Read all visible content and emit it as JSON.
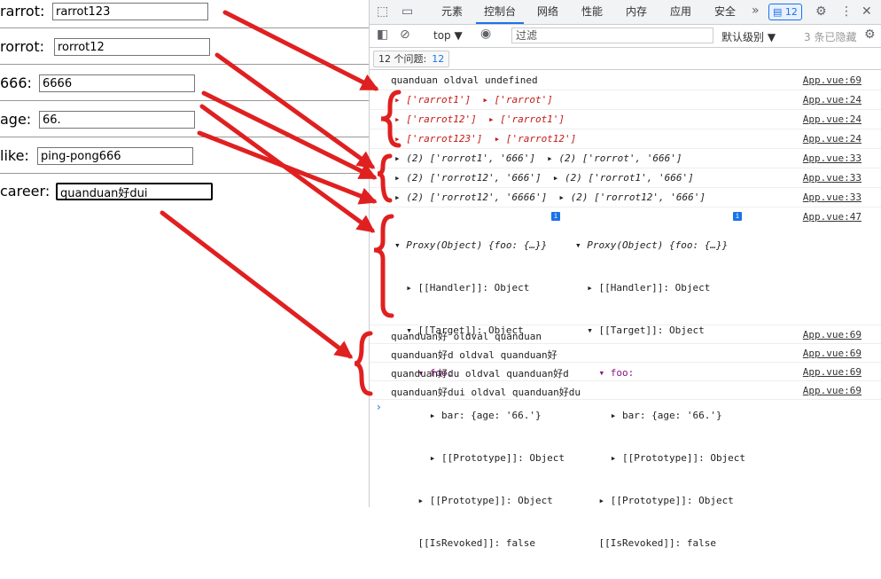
{
  "form": {
    "rows": [
      {
        "label": "rarrot:",
        "value": "rarrot123"
      },
      {
        "label": "rorrot:",
        "value": "rorrot12"
      },
      {
        "label": "666:",
        "value": "6666"
      },
      {
        "label": "age:",
        "value": "66."
      },
      {
        "label": "like:",
        "value": "ping-pong666"
      },
      {
        "label": "career:",
        "value": "quanduan好dui"
      }
    ]
  },
  "devtools": {
    "tabs": [
      "元素",
      "控制台",
      "网络",
      "性能",
      "内存",
      "应用",
      "安全"
    ],
    "active_tab": "控制台",
    "more": "»",
    "badge_count": "12",
    "context": "top ▼",
    "filter_placeholder": "过滤",
    "level": "默认级别 ▼",
    "hidden": "3 条已隐藏",
    "issues_label": "12 个问题:",
    "issues_count": "12"
  },
  "console": {
    "messages": [
      {
        "text": "quanduan oldval undefined",
        "source": "App.vue:69"
      },
      {
        "text": "▸ ['rarrot1']  ▸ ['rarrot']",
        "source": "App.vue:24"
      },
      {
        "text": "▸ ['rarrot12']  ▸ ['rarrot1']",
        "source": "App.vue:24"
      },
      {
        "text": "▸ ['rarrot123']  ▸ ['rarrot12']",
        "source": "App.vue:24"
      },
      {
        "text": "▸ (2) ['rorrot1', '666']  ▸ (2) ['rorrot', '666']",
        "source": "App.vue:33"
      },
      {
        "text": "▸ (2) ['rorrot12', '666']  ▸ (2) ['rorrot1', '666']",
        "source": "App.vue:33"
      },
      {
        "text": "▸ (2) ['rorrot12', '6666']  ▸ (2) ['rorrot12', '666']",
        "source": "App.vue:33"
      },
      {
        "text": "quanduan好 oldval quanduan",
        "source": "App.vue:69"
      },
      {
        "text": "quanduan好d oldval quanduan好",
        "source": "App.vue:69"
      },
      {
        "text": "quanduan好du oldval quanduan好d",
        "source": "App.vue:69"
      },
      {
        "text": "quanduan好dui oldval quanduan好du",
        "source": "App.vue:69"
      }
    ],
    "proxy": {
      "source": "App.vue:47",
      "left": [
        "▾ Proxy(Object) {foo: {…}}",
        "  ▸ [[Handler]]: Object",
        "  ▾ [[Target]]: Object",
        "    ▾ foo:",
        "      ▸ bar: {age: '66.'}",
        "      ▸ [[Prototype]]: Object",
        "    ▸ [[Prototype]]: Object",
        "    [[IsRevoked]]: false"
      ],
      "right": [
        "▾ Proxy(Object) {foo: {…}}",
        "  ▸ [[Handler]]: Object",
        "  ▾ [[Target]]: Object",
        "    ▾ foo:",
        "      ▸ bar: {age: '66.'}",
        "      ▸ [[Prototype]]: Object",
        "    ▸ [[Prototype]]: Object",
        "    [[IsRevoked]]: false"
      ]
    },
    "prompt": "›"
  },
  "colors": {
    "annotation": "#e02020",
    "accent": "#1a73e8"
  }
}
